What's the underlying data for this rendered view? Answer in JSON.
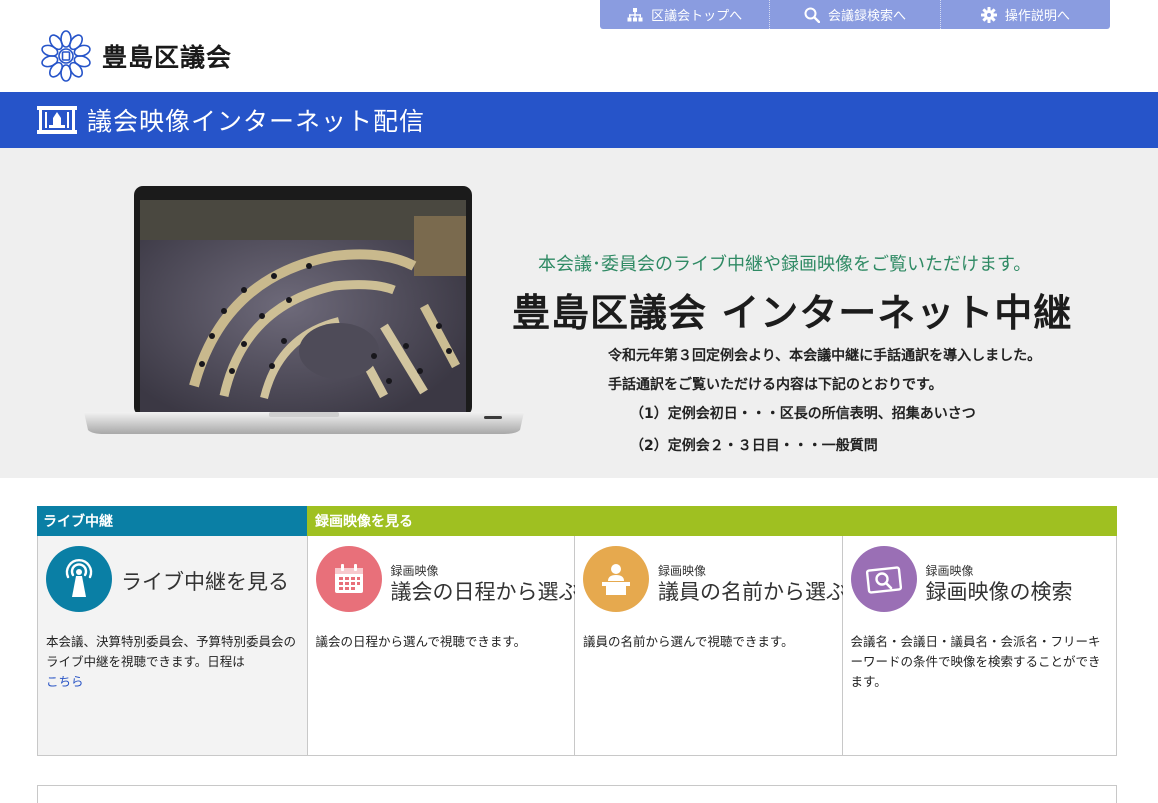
{
  "nav": {
    "items": [
      {
        "label": "区議会トップへ",
        "icon": "sitemap-icon"
      },
      {
        "label": "会議録検索へ",
        "icon": "search-icon"
      },
      {
        "label": "操作説明へ",
        "icon": "gear-icon"
      }
    ]
  },
  "logo": {
    "text": "豊島区議会",
    "icon": "ward-emblem-icon"
  },
  "banner": {
    "title": "議会映像インターネット配信",
    "icon": "film-icon"
  },
  "hero": {
    "subtitle": "本会議･委員会のライブ中継や録画映像をご覧いただけます。",
    "title": "豊島区議会 インターネット中継",
    "note1": "令和元年第３回定例会より、本会議中継に手話通訳を導入しました。",
    "note2": "手話通訳をご覧いただける内容は下記のとおりです。",
    "note3": "（1）定例会初日・・・区長の所信表明、招集あいさつ",
    "note4": "（2）定例会２・３日目・・・一般質問"
  },
  "categories": {
    "live": "ライブ中継",
    "recorded": "録画映像を見る"
  },
  "cards": {
    "live": {
      "title": "ライブ中継を見る",
      "desc": "本会議、決算特別委員会、予算特別委員会のライブ中継を視聴できます。日程は",
      "link": "こちら",
      "icon": "broadcast-icon"
    },
    "schedule": {
      "small": "録画映像",
      "title": "議会の日程から選ぶ",
      "desc": "議会の日程から選んで視聴できます。",
      "icon": "calendar-icon"
    },
    "member": {
      "small": "録画映像",
      "title": "議員の名前から選ぶ",
      "desc": "議員の名前から選んで視聴できます。",
      "icon": "speaker-icon"
    },
    "search": {
      "small": "録画映像",
      "title": "録画映像の検索",
      "desc": "会議名・会議日・議員名・会派名・フリーキーワードの条件で映像を検索することができます。",
      "icon": "video-search-icon"
    }
  },
  "colors": {
    "nav": "#8a9ce0",
    "banner": "#2654c9",
    "live_header": "#0a7fa5",
    "recorded_header": "#9fc021",
    "live_icon": "#0a7fa5",
    "schedule_icon": "#e8707a",
    "member_icon": "#e6a94e",
    "search_icon": "#9a6fb5"
  }
}
